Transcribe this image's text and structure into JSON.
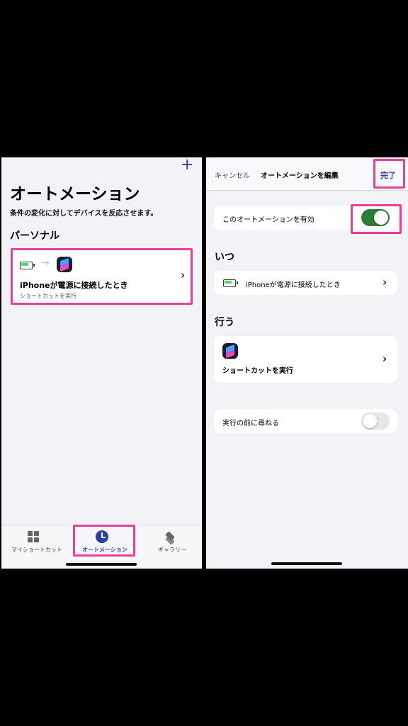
{
  "left": {
    "add_icon": "+",
    "title": "オートメーション",
    "subtitle": "条件の変化に対してデバイスを反応させます。",
    "section_personal": "パーソナル",
    "automation_card": {
      "arrow": "→",
      "title": "iPhoneが電源に接続したとき",
      "subtitle": "ショートカットを実行",
      "chevron": "›"
    },
    "tabs": [
      {
        "label": "マイショートカット",
        "icon": "grid-icon"
      },
      {
        "label": "オートメーション",
        "icon": "clock-icon",
        "selected": true
      },
      {
        "label": "ギャラリー",
        "icon": "layers-icon"
      }
    ]
  },
  "right": {
    "cancel": "キャンセル",
    "nav_title": "オートメーションを編集",
    "done": "完了",
    "enable_label": "このオートメーションを有効",
    "enable_on": true,
    "when_header": "いつ",
    "when_item": "iPhoneが電源に接続したとき",
    "do_header": "行う",
    "action_label": "ショートカットを実行",
    "ask_label": "実行の前に尋ねる",
    "ask_on": false,
    "chevron": "›"
  },
  "colors": {
    "highlight": "#e8409a",
    "accent_blue": "#2f3fa8",
    "toggle_on": "#2d7d3a",
    "toggle_off": "#e5e5ea"
  }
}
